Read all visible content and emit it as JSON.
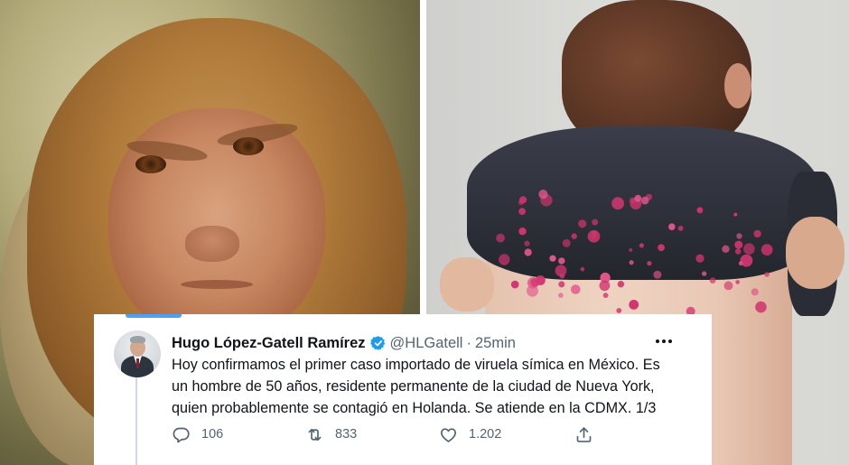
{
  "images": {
    "left": {
      "subject": "monkey-photo"
    },
    "right": {
      "subject": "back-rash-photo"
    }
  },
  "tweet": {
    "author_name": "Hugo López-Gatell Ramírez",
    "handle": "@HLGatell",
    "separator": "·",
    "time": "25min",
    "verified": true,
    "text_lines": [
      "Hoy confirmamos el primer caso importado de viruela símica en México. Es",
      "un hombre de 50 años, residente permanente de la ciudad de Nueva York,",
      "quien probablemente se contagió en Holanda. Se atiende en la CDMX. 1/3"
    ],
    "actions": {
      "reply_count": "106",
      "retweet_count": "833",
      "like_count": "1.202"
    }
  },
  "colors": {
    "accent": "#1d9bf0",
    "text_primary": "#0f1419",
    "text_secondary": "#536471"
  },
  "icons": [
    "verified-badge-icon",
    "more-options-icon",
    "reply-icon",
    "retweet-icon",
    "like-icon",
    "share-icon"
  ]
}
